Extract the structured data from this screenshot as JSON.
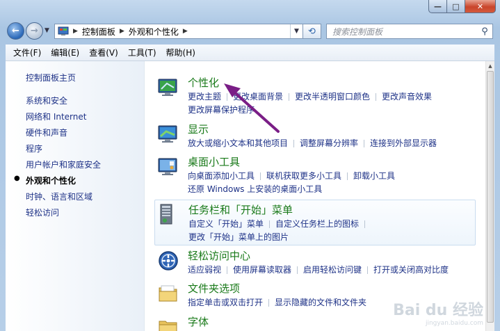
{
  "window": {
    "min_label": "—",
    "max_label": "□",
    "close_label": "✕"
  },
  "nav": {
    "breadcrumbs": [
      "控制面板",
      "外观和个性化"
    ],
    "search_placeholder": "搜索控制面板"
  },
  "menubar": [
    "文件(F)",
    "编辑(E)",
    "查看(V)",
    "工具(T)",
    "帮助(H)"
  ],
  "sidebar": {
    "home": "控制面板主页",
    "items": [
      {
        "label": "系统和安全"
      },
      {
        "label": "网络和 Internet"
      },
      {
        "label": "硬件和声音"
      },
      {
        "label": "程序"
      },
      {
        "label": "用户帐户和家庭安全"
      },
      {
        "label": "外观和个性化",
        "current": true
      },
      {
        "label": "时钟、语言和区域"
      },
      {
        "label": "轻松访问"
      }
    ]
  },
  "categories": [
    {
      "title": "个性化",
      "icon": "personalization-icon",
      "links": [
        [
          "更改主题",
          "更改桌面背景",
          "更改半透明窗口颜色",
          "更改声音效果"
        ],
        [
          "更改屏幕保护程序"
        ]
      ]
    },
    {
      "title": "显示",
      "icon": "display-icon",
      "links": [
        [
          "放大或缩小文本和其他项目",
          "调整屏幕分辨率",
          "连接到外部显示器"
        ]
      ]
    },
    {
      "title": "桌面小工具",
      "icon": "gadgets-icon",
      "links": [
        [
          "向桌面添加小工具",
          "联机获取更多小工具",
          "卸载小工具"
        ],
        [
          "还原 Windows 上安装的桌面小工具"
        ]
      ]
    },
    {
      "title": "任务栏和「开始」菜单",
      "icon": "taskbar-icon",
      "highlight": true,
      "links": [
        [
          "自定义「开始」菜单",
          "自定义任务栏上的图标"
        ],
        [
          "更改「开始」菜单上的图片"
        ]
      ]
    },
    {
      "title": "轻松访问中心",
      "icon": "ease-of-access-icon",
      "links": [
        [
          "适应弱视",
          "使用屏幕读取器",
          "启用轻松访问键",
          "打开或关闭高对比度"
        ]
      ]
    },
    {
      "title": "文件夹选项",
      "icon": "folder-options-icon",
      "links": [
        [
          "指定单击或双击打开",
          "显示隐藏的文件和文件夹"
        ]
      ]
    },
    {
      "title": "字体",
      "icon": "fonts-icon",
      "links": []
    }
  ],
  "watermark": {
    "text": "Bai du 经验",
    "sub": "jingyan.baidu.com"
  },
  "colors": {
    "link": "#1e3287",
    "category_title": "#1a7a1a",
    "arrow": "#7a1e86"
  }
}
